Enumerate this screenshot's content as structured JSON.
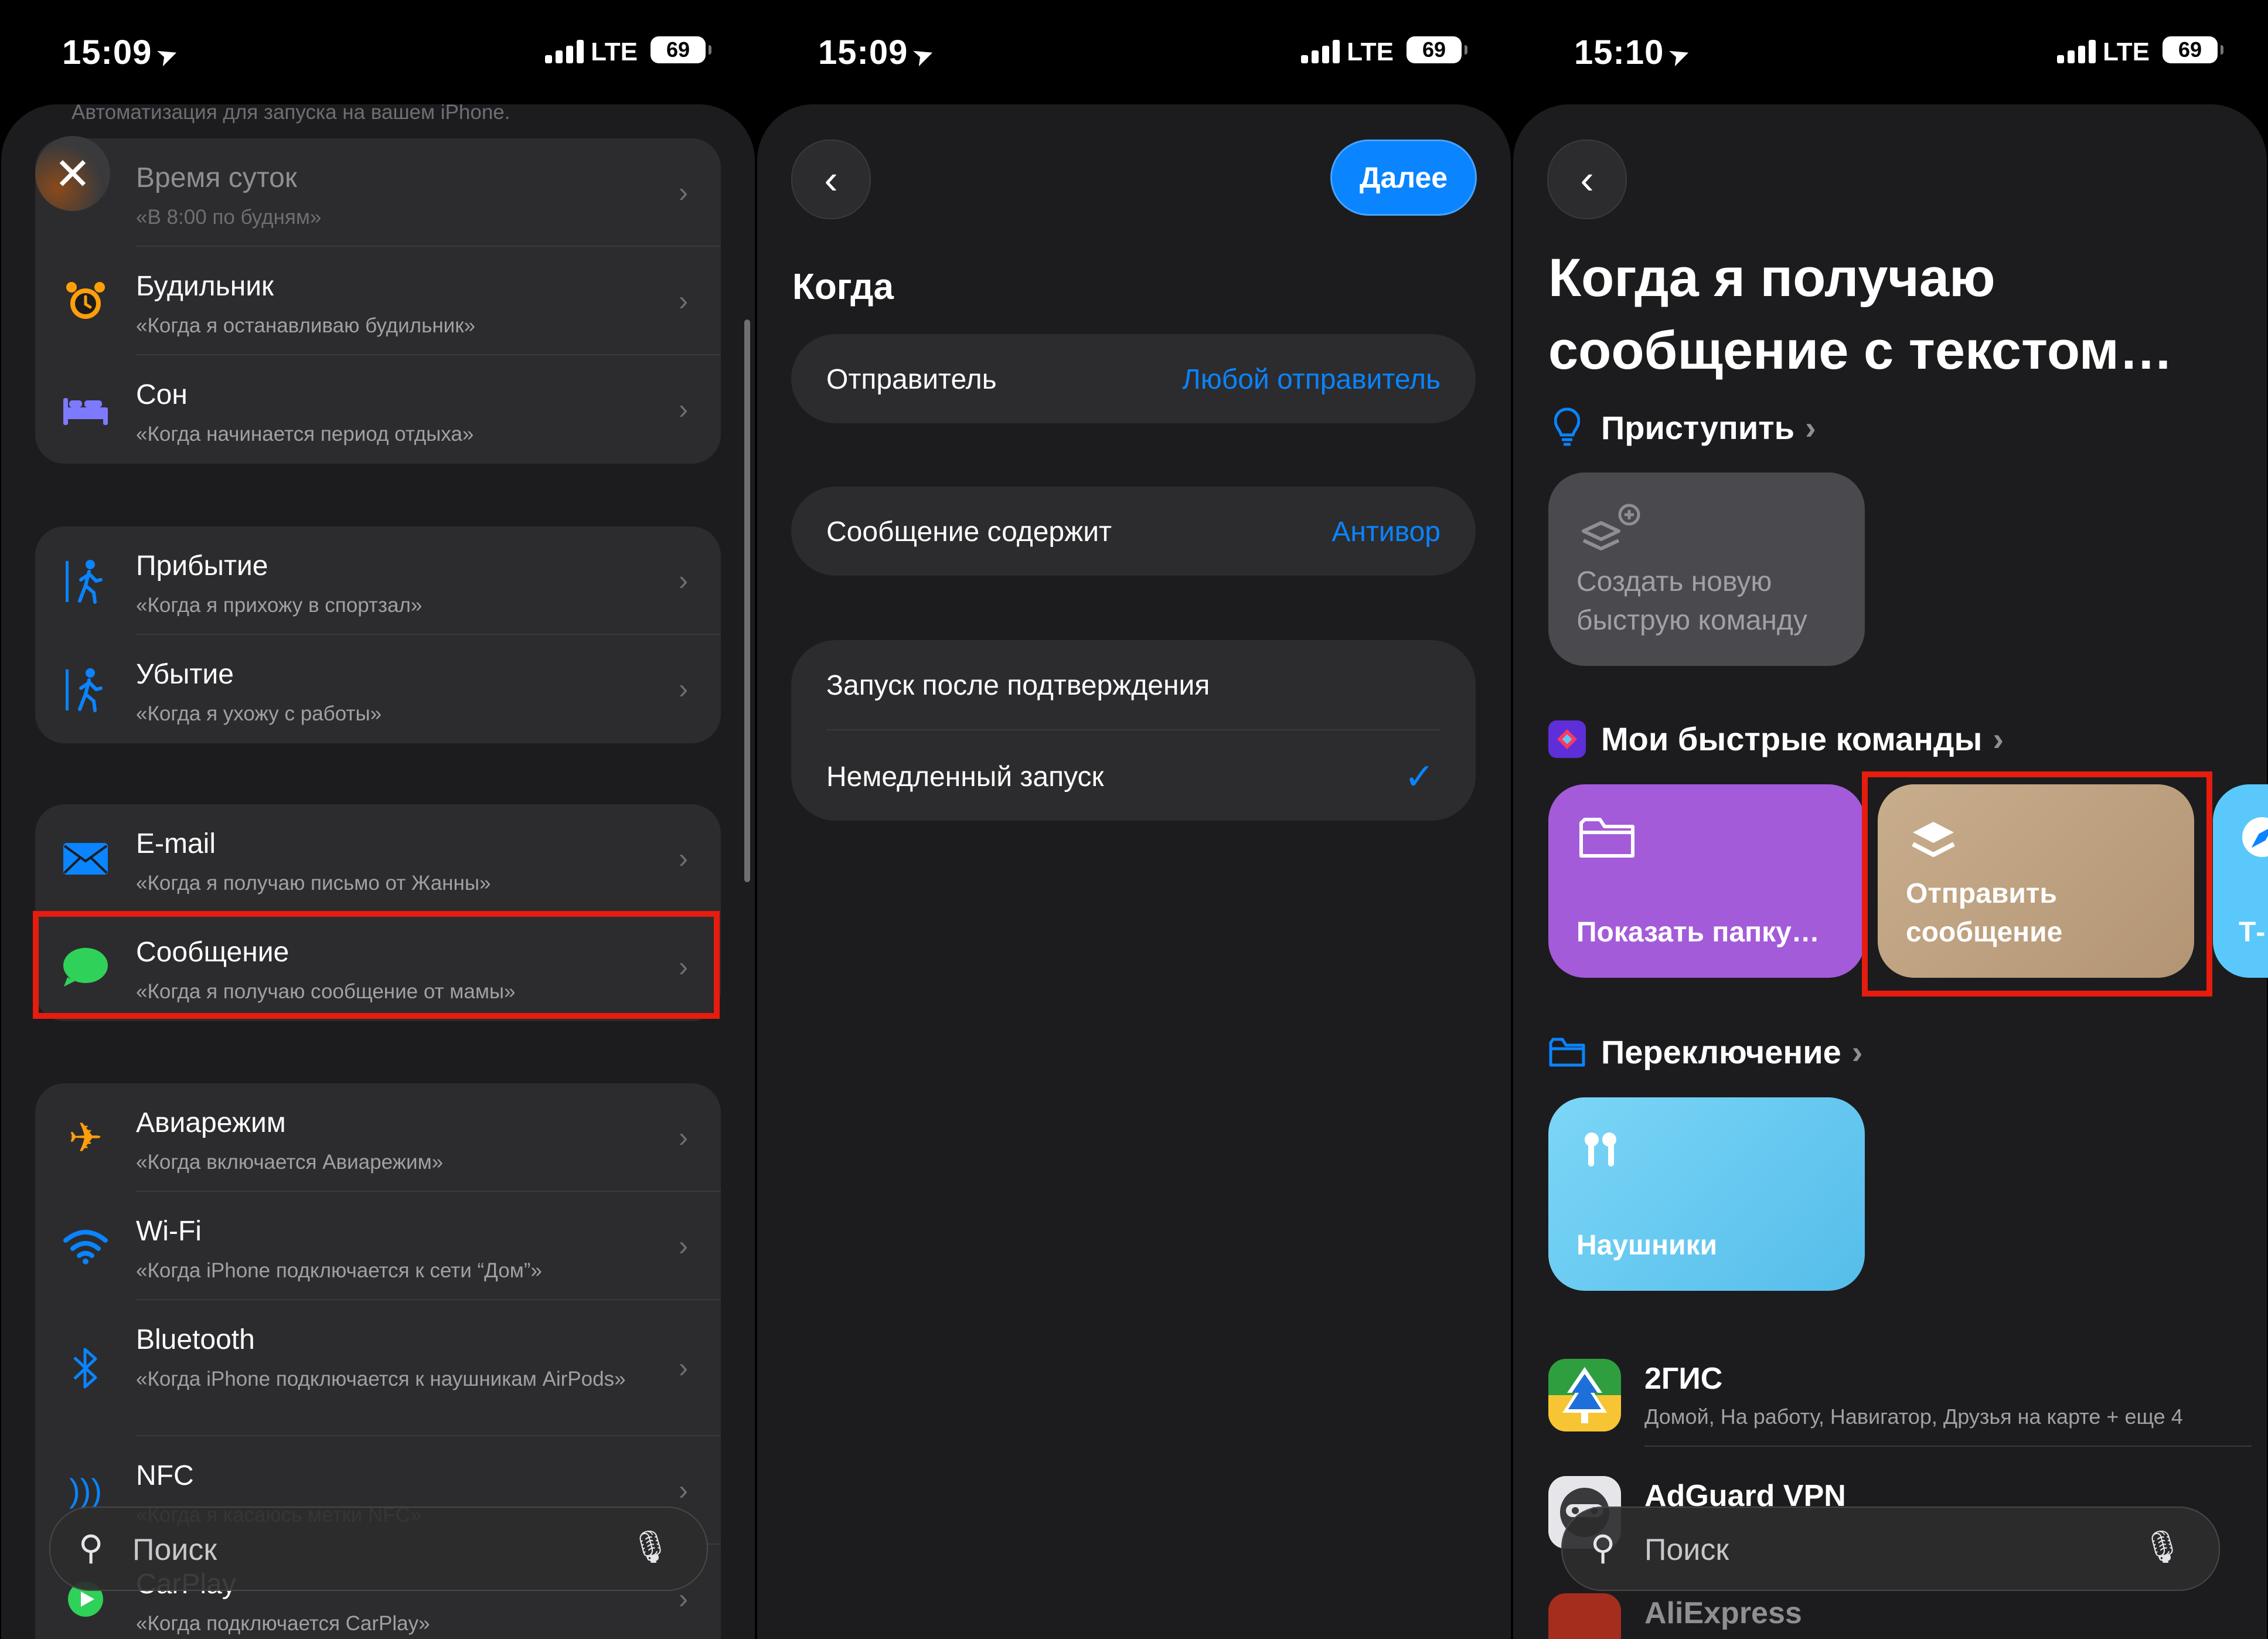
{
  "status_bars": [
    {
      "time": "15:09",
      "network": "LTE",
      "battery": "69"
    },
    {
      "time": "15:09",
      "network": "LTE",
      "battery": "69"
    },
    {
      "time": "15:10",
      "network": "LTE",
      "battery": "69"
    }
  ],
  "panel1": {
    "top_hint": "Автоматизация для запуска на вашем iPhone.",
    "groups": [
      [
        {
          "title": "Время суток",
          "subtitle": "«В 8:00 по будням»",
          "icon": "clock-icon"
        },
        {
          "title": "Будильник",
          "subtitle": "«Когда я останавливаю будильник»",
          "icon": "alarm-icon"
        },
        {
          "title": "Сон",
          "subtitle": "«Когда начинается период отдыха»",
          "icon": "bed-icon"
        }
      ],
      [
        {
          "title": "Прибытие",
          "subtitle": "«Когда я прихожу в спортзал»",
          "icon": "walk-in-icon"
        },
        {
          "title": "Убытие",
          "subtitle": "«Когда я ухожу с работы»",
          "icon": "walk-out-icon"
        }
      ],
      [
        {
          "title": "E-mail",
          "subtitle": "«Когда я получаю письмо от Жанны»",
          "icon": "mail-icon"
        },
        {
          "title": "Сообщение",
          "subtitle": "«Когда я получаю сообщение от мамы»",
          "icon": "message-icon"
        }
      ],
      [
        {
          "title": "Авиарежим",
          "subtitle": "«Когда включается Авиарежим»",
          "icon": "airplane-icon"
        },
        {
          "title": "Wi-Fi",
          "subtitle": "«Когда iPhone подключается к сети “Дом”»",
          "icon": "wifi-icon"
        },
        {
          "title": "Bluetooth",
          "subtitle": "«Когда iPhone подключается к наушникам AirPods»",
          "icon": "bluetooth-icon"
        },
        {
          "title": "NFC",
          "subtitle": "«Когда я касаюсь метки NFC»",
          "icon": "nfc-icon"
        },
        {
          "title": "CarPlay",
          "subtitle": "«Когда подключается CarPlay»",
          "icon": "carplay-icon"
        }
      ]
    ],
    "search_placeholder": "Поиск"
  },
  "panel2": {
    "next_label": "Далее",
    "section_title": "Когда",
    "sender_label": "Отправитель",
    "sender_value": "Любой отправитель",
    "contains_label": "Сообщение содержит",
    "contains_value": "Антивор",
    "option_confirm": "Запуск после подтверждения",
    "option_immediate": "Немедленный запуск"
  },
  "panel3": {
    "title": "Когда я получаю сообщение с текстом…",
    "start_section": "Приступить",
    "new_shortcut": "Создать новую быструю команду",
    "my_section": "Мои быстрые команды",
    "my_tiles": [
      {
        "label": "Показать папку…",
        "color": "#a45bd9"
      },
      {
        "label": "Отправить сообщение",
        "color": "#bfa484"
      },
      {
        "label": "Т-",
        "color": "#5ac8fa"
      }
    ],
    "switch_section": "Переключение",
    "switch_tile": "Наушники",
    "apps": [
      {
        "name": "2ГИС",
        "detail": "Домой, На работу, Навигатор, Друзья на карте + еще 4"
      },
      {
        "name": "AdGuard VPN",
        "detail": ""
      },
      {
        "name": "AliExpress",
        "detail": ""
      }
    ],
    "search_placeholder": "Поиск"
  },
  "colors": {
    "accent": "#0a84ff",
    "highlight": "#e61c0e"
  }
}
